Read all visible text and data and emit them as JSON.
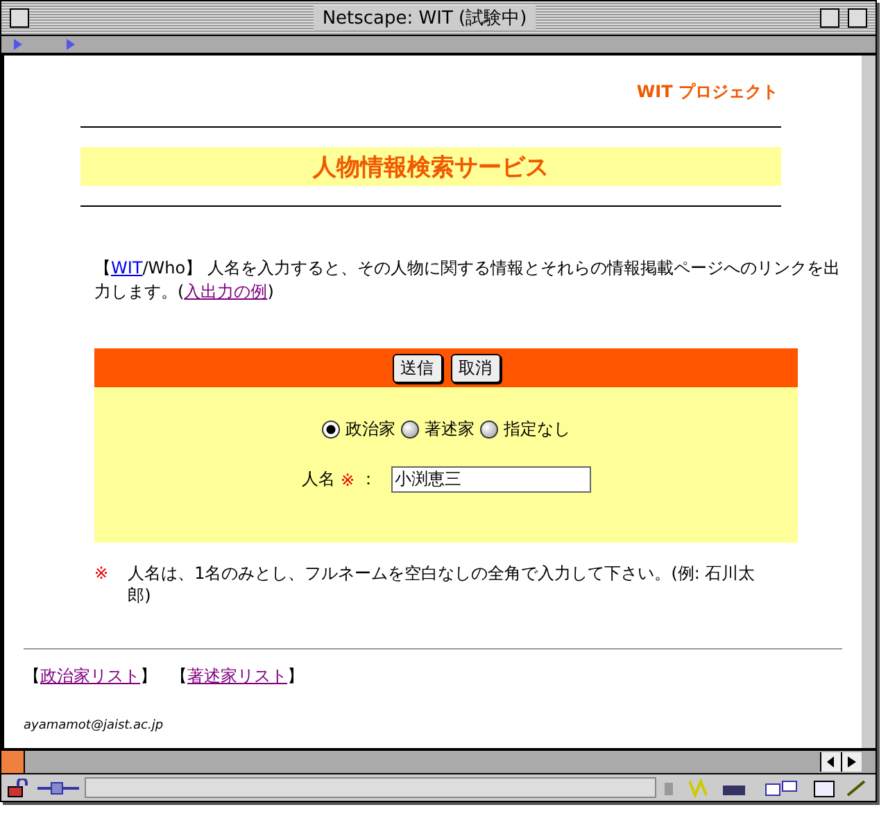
{
  "window": {
    "title": "Netscape: WIT (試験中)"
  },
  "page": {
    "project_label": "WIT プロジェクト",
    "banner_title": "人物情報検索サービス",
    "intro": [
      {
        "kind": "text",
        "text": "【"
      },
      {
        "kind": "link",
        "text": "WIT",
        "visited": false
      },
      {
        "kind": "text",
        "text": "/Who】 人名を入力すると、その人物に関する情報とそれらの情報掲載ページへのリンクを出力します。("
      },
      {
        "kind": "link",
        "text": "入出力の例",
        "visited": true
      },
      {
        "kind": "text",
        "text": ")"
      }
    ],
    "form": {
      "buttons": [
        "送信",
        "取消"
      ],
      "radios": [
        {
          "label": "政治家",
          "selected": true
        },
        {
          "label": "著述家",
          "selected": false
        },
        {
          "label": "指定なし",
          "selected": false
        }
      ],
      "name_label": "人名",
      "required_mark": "※",
      "colon": "：",
      "name_value": "小渕恵三"
    },
    "note": {
      "mark": "※",
      "text": "人名は、1名のみとし、フルネームを空白なしの全角で入力して下さい。(例: 石川太郎)"
    },
    "footer_links": [
      {
        "open": "【",
        "text": "政治家リスト",
        "close": "】",
        "visited": true
      },
      {
        "open": "【",
        "text": "著述家リスト",
        "close": "】",
        "visited": true
      }
    ],
    "email": "ayamamot@jaist.ac.jp"
  }
}
